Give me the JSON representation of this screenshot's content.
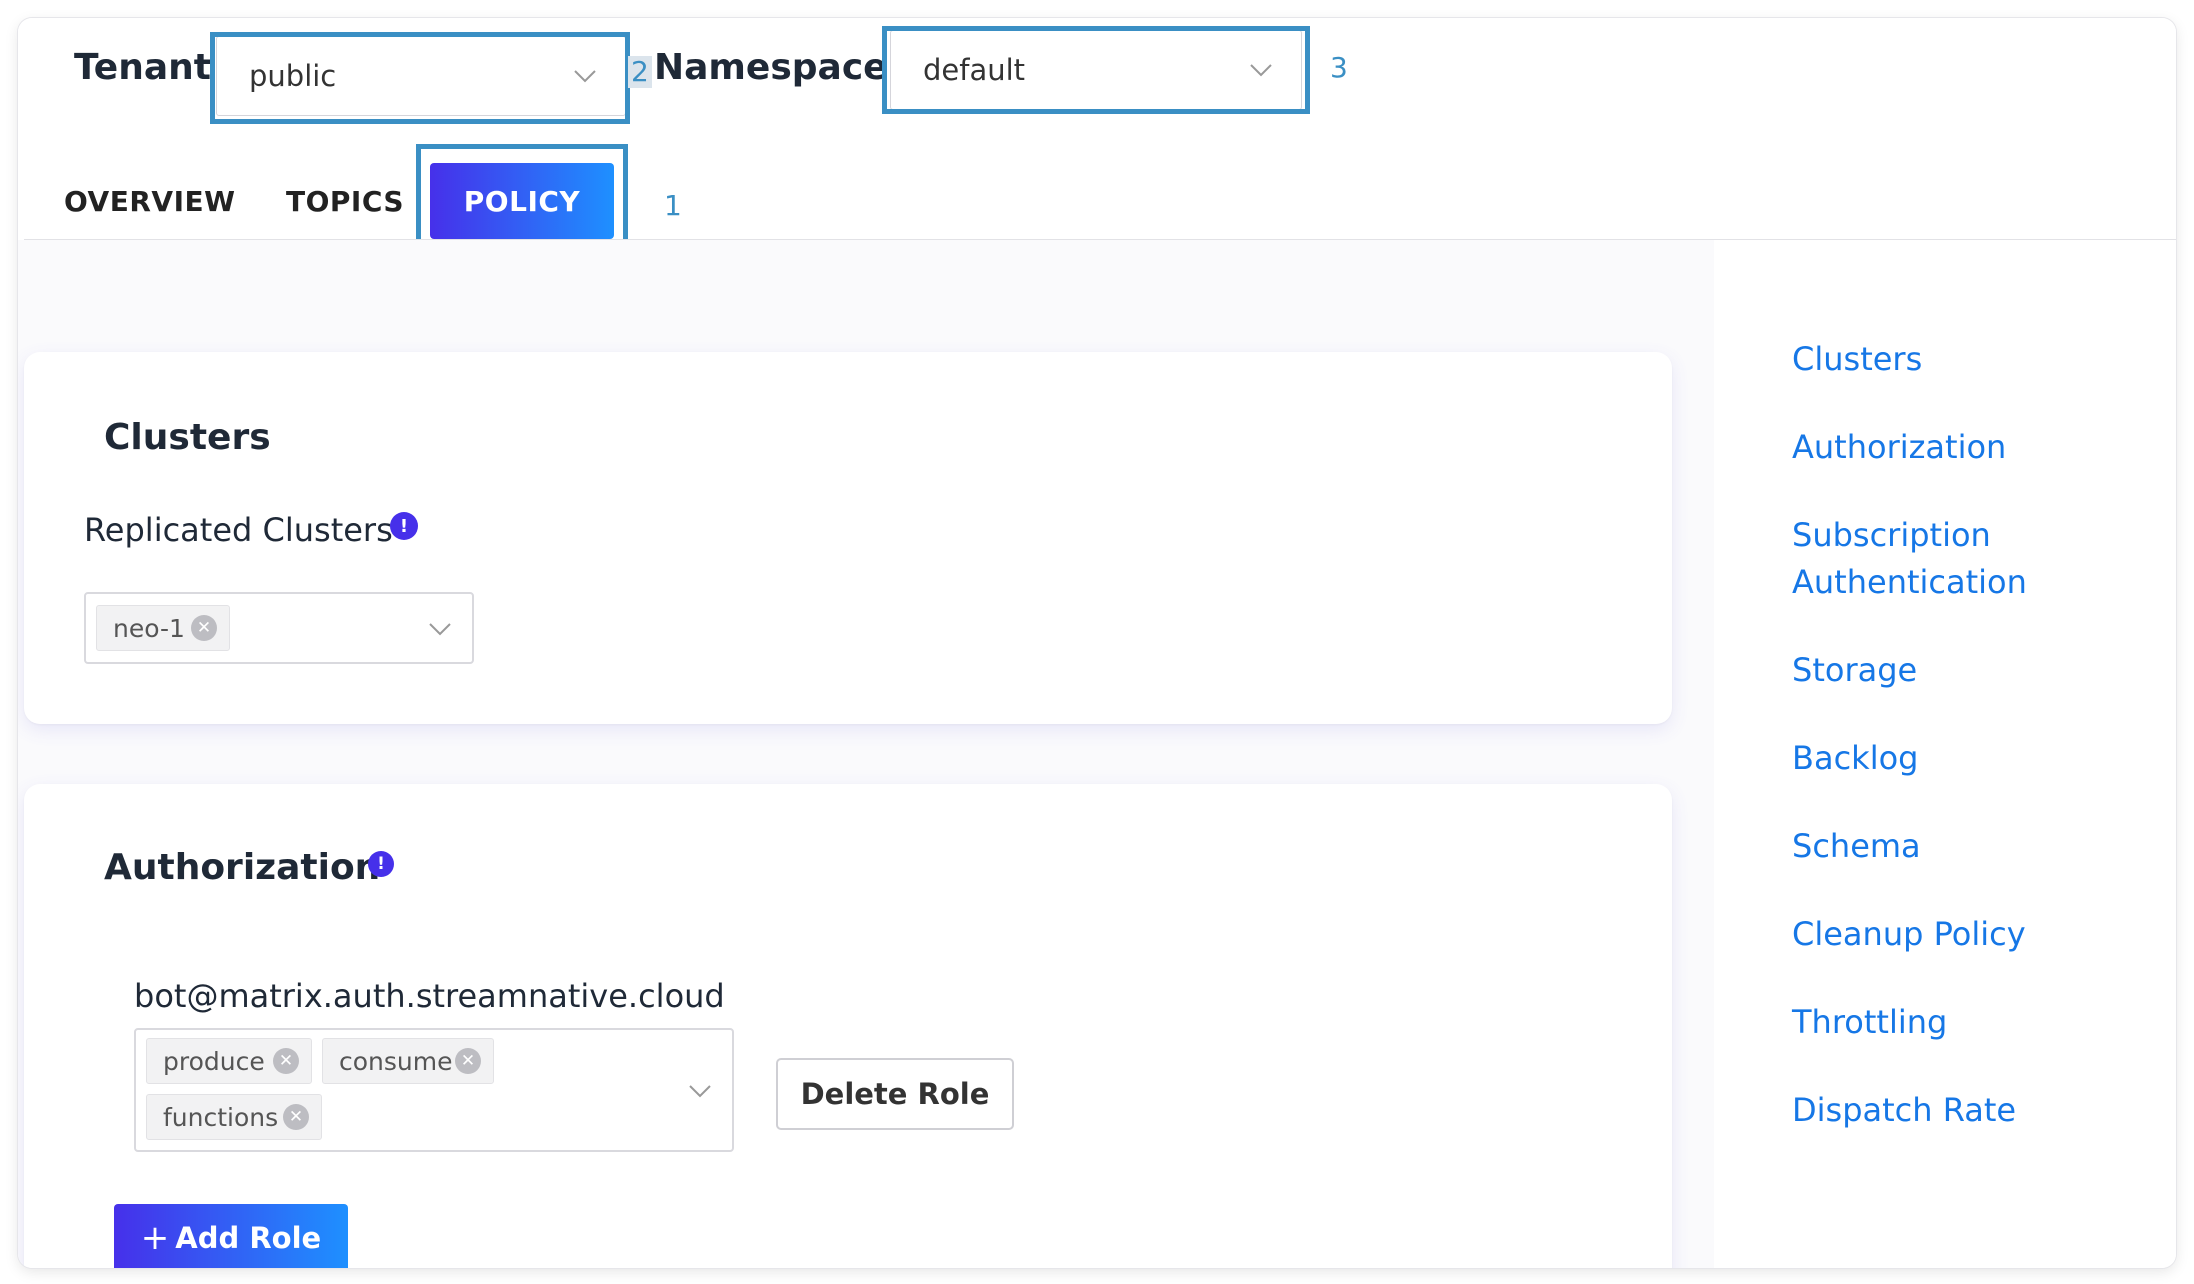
{
  "header": {
    "tenant_label": "Tenant",
    "tenant_value": "public",
    "namespace_label": "Namespace",
    "namespace_value": "default",
    "markers": [
      "1",
      "2",
      "3"
    ]
  },
  "tabs": [
    {
      "label": "OVERVIEW",
      "active": false
    },
    {
      "label": "TOPICS",
      "active": false
    },
    {
      "label": "POLICY",
      "active": true
    }
  ],
  "clusters_card": {
    "title": "Clusters",
    "field_label": "Replicated Clusters",
    "info_icon": "info-icon",
    "selected": [
      "neo-1"
    ]
  },
  "authorization_card": {
    "title": "Authorization",
    "info_icon": "info-icon",
    "roles": [
      {
        "name": "bot@matrix.auth.streamnative.cloud",
        "permissions": [
          "produce",
          "consume",
          "functions"
        ]
      }
    ],
    "delete_role_label": "Delete Role",
    "add_role_label": "Add Role"
  },
  "side_nav": {
    "items": [
      "Clusters",
      "Authorization",
      "Subscription Authentication",
      "Storage",
      "Backlog",
      "Schema",
      "Cleanup Policy",
      "Throttling",
      "Dispatch Rate"
    ]
  },
  "colors": {
    "primary_gradient_start": "#4630ea",
    "primary_gradient_end": "#1e90ff",
    "link": "#1677e6",
    "highlight_box": "#3a8fc4"
  }
}
